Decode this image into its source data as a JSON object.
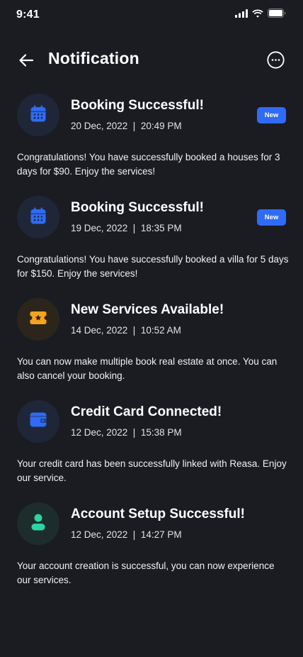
{
  "status_bar": {
    "time": "9:41"
  },
  "header": {
    "title": "Notification",
    "back_icon": "arrow-left-icon",
    "more_icon": "more-horizontal-icon"
  },
  "colors": {
    "background": "#1a1c22",
    "accent": "#2f6bf6",
    "orange": "#f5a21c",
    "green": "#2ed3a5"
  },
  "notifications": [
    {
      "icon": "calendar-icon",
      "title": "Booking Successful!",
      "time": "20 Dec, 2022  |  20:49 PM",
      "badge": "New",
      "body": "Congratulations! You have successfully booked a houses for 3 days for $90. Enjoy the services!"
    },
    {
      "icon": "calendar-icon",
      "title": "Booking Successful!",
      "time": "19 Dec, 2022  |  18:35 PM",
      "badge": "New",
      "body": "Congratulations! You have successfully booked a villa for 5 days for $150. Enjoy the services!"
    },
    {
      "icon": "ticket-star-icon",
      "title": "New Services Available!",
      "time": "14 Dec, 2022  |  10:52 AM",
      "badge": "",
      "body": "You can now make multiple book real estate at once. You can also cancel your booking."
    },
    {
      "icon": "wallet-icon",
      "title": "Credit Card Connected!",
      "time": "12 Dec, 2022  |  15:38 PM",
      "badge": "",
      "body": "Your credit card has been successfully linked with Reasa. Enjoy our service."
    },
    {
      "icon": "user-icon",
      "title": "Account Setup Successful!",
      "time": "12 Dec, 2022  |  14:27 PM",
      "badge": "",
      "body": "Your account creation is successful, you can now experience our services."
    }
  ]
}
